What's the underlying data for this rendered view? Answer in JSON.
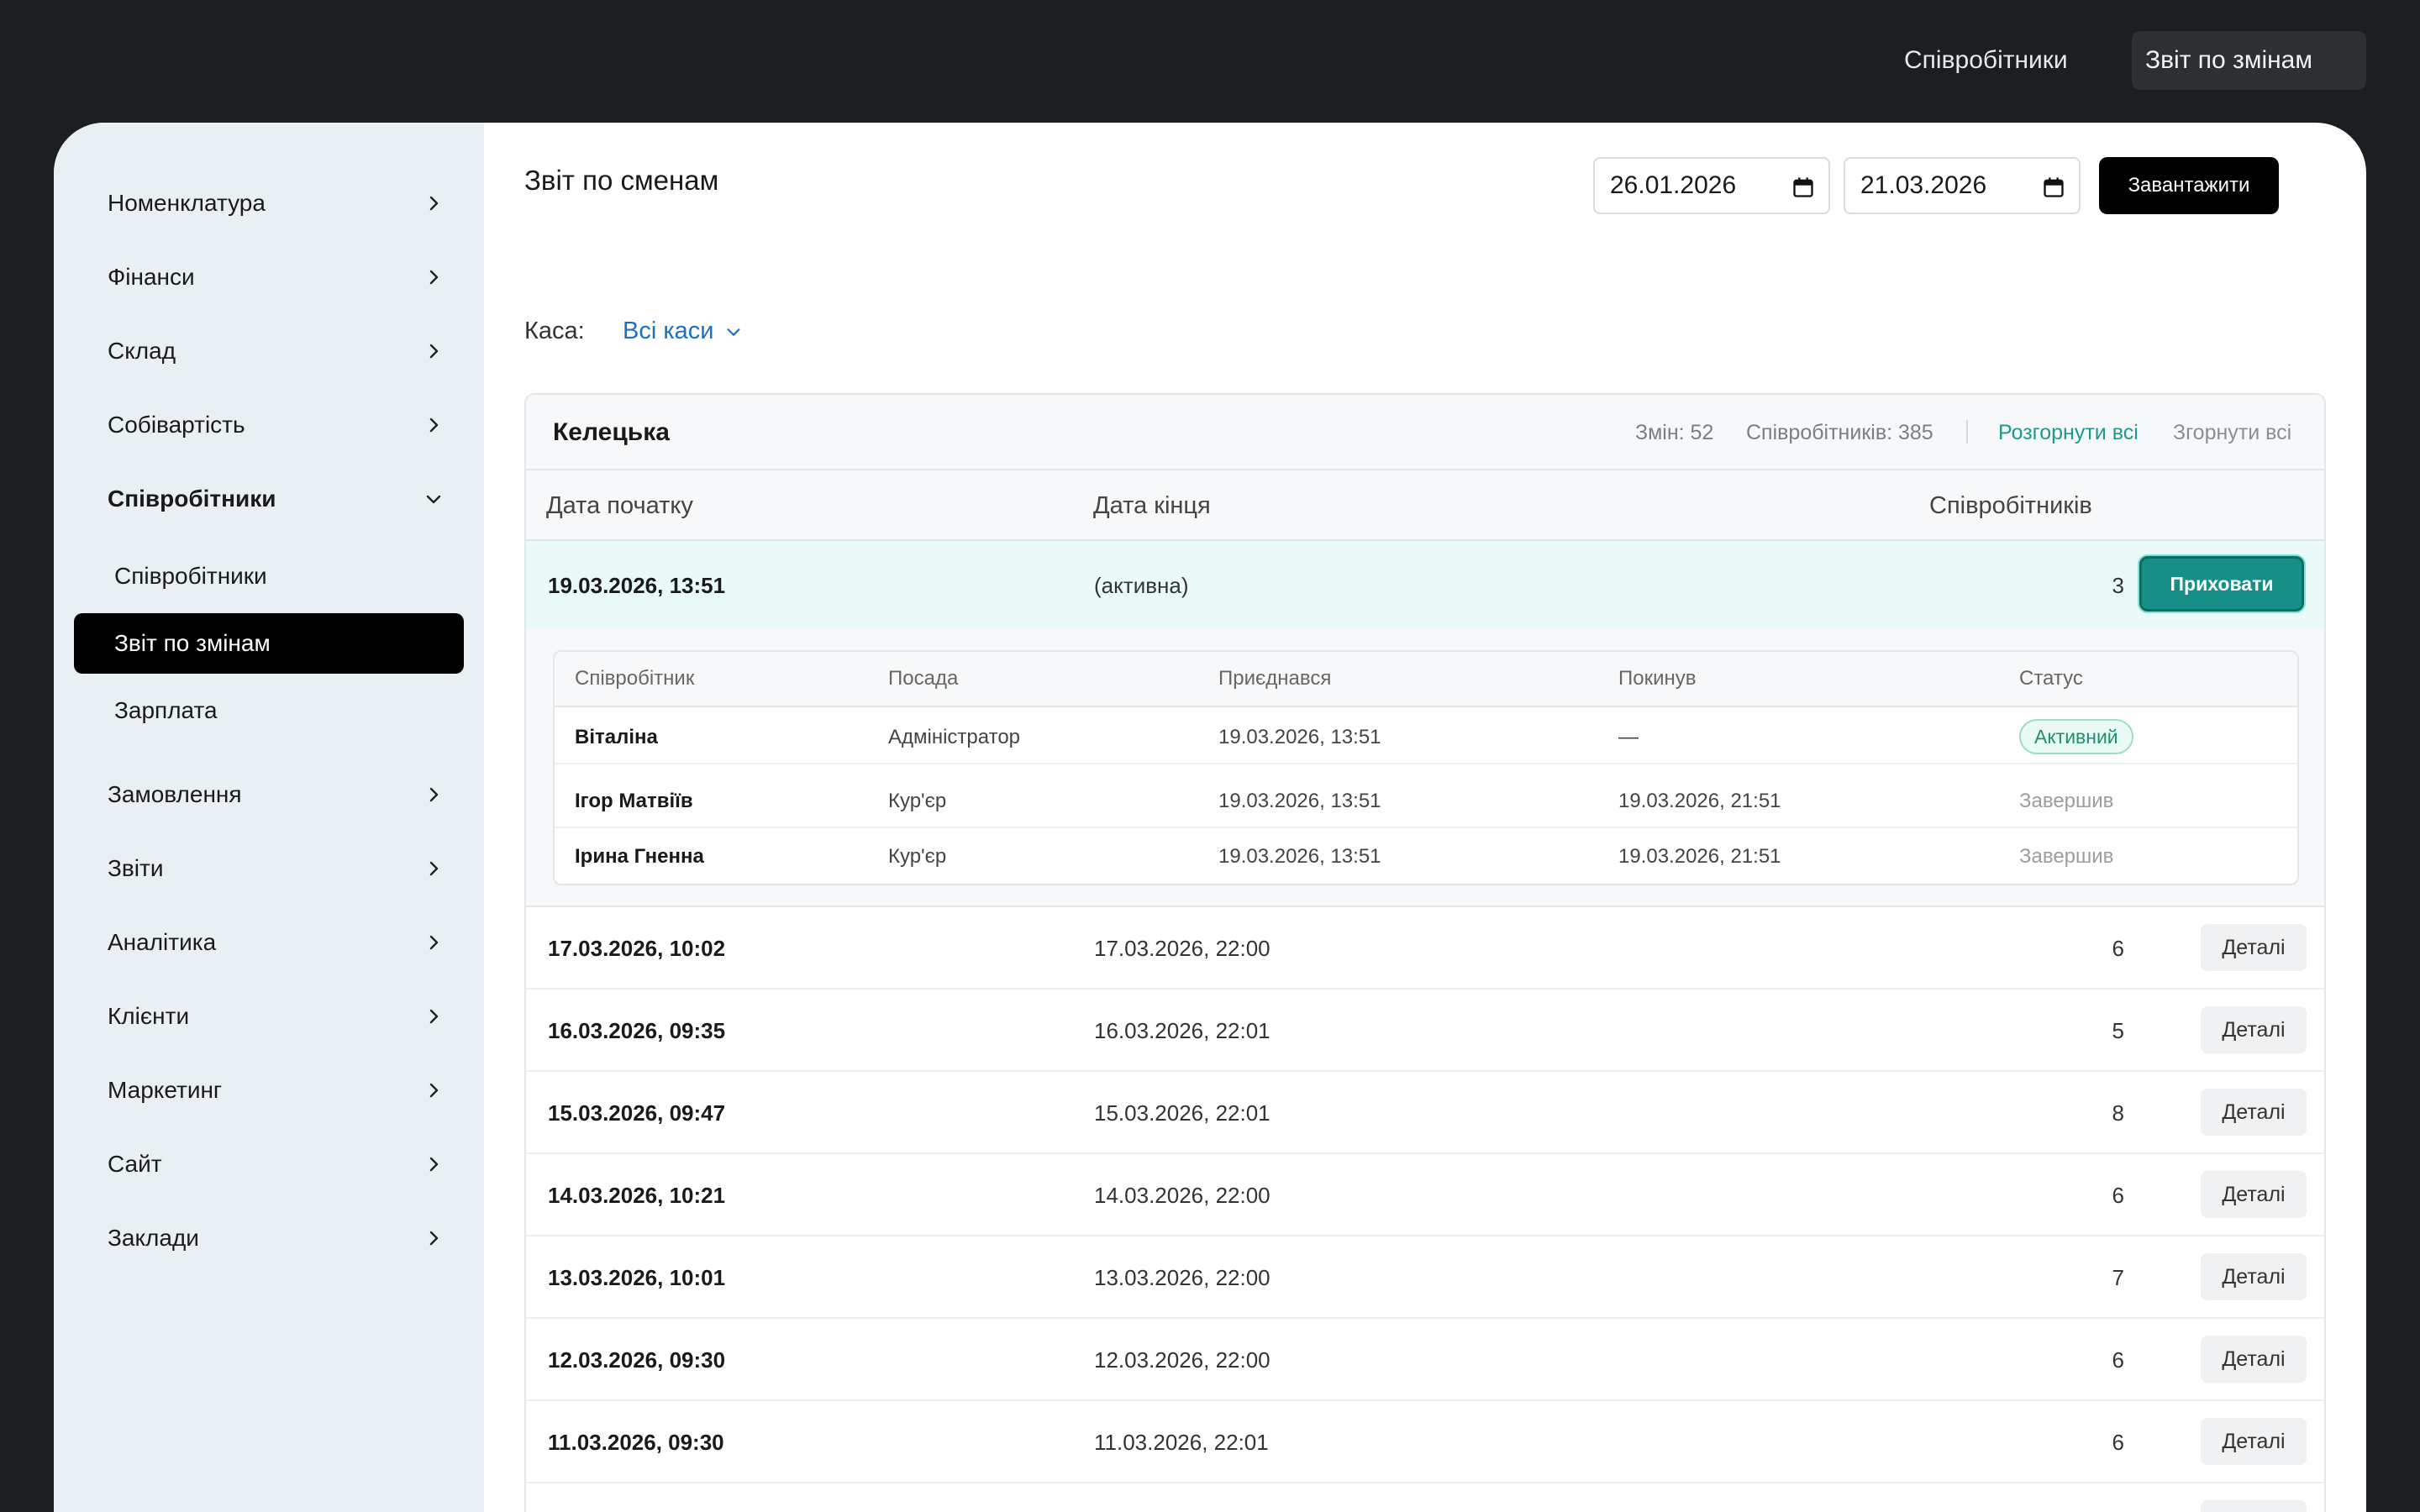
{
  "topnav": {
    "employees_link": "Співробітники",
    "shift_report_link": "Звіт по змінам"
  },
  "sidebar": {
    "items": [
      {
        "label": "Номенклатура"
      },
      {
        "label": "Фінанси"
      },
      {
        "label": "Склад"
      },
      {
        "label": "Собівартість"
      },
      {
        "label": "Співробітники",
        "expanded": true
      },
      {
        "label": "Замовлення"
      },
      {
        "label": "Звіти"
      },
      {
        "label": "Аналітика"
      },
      {
        "label": "Клієнти"
      },
      {
        "label": "Маркетинг"
      },
      {
        "label": "Сайт"
      },
      {
        "label": "Заклади"
      }
    ],
    "subitems": [
      {
        "label": "Співробітники"
      },
      {
        "label": "Звіт по змінам",
        "active": true
      },
      {
        "label": "Зарплата"
      }
    ]
  },
  "main": {
    "title": "Звіт по сменам",
    "date_from": "26.01.2026",
    "date_to": "21.03.2026",
    "load_button": "Завантажити",
    "kasa_label": "Каса:",
    "kasa_value": "Всі каси"
  },
  "group": {
    "name": "Келецька",
    "shifts_stat": "Змін: 52",
    "employees_stat": "Співробітників: 385",
    "expand_all": "Розгорнути всі",
    "collapse_all": "Згорнути всі",
    "columns": [
      "Дата початку",
      "Дата кінця",
      "Співробітників"
    ],
    "active_shift": {
      "start": "19.03.2026, 13:51",
      "end": "(активна)",
      "count": "3",
      "hide_button": "Приховати",
      "detail_columns": [
        "Співробітник",
        "Посада",
        "Приєднався",
        "Покинув",
        "Статус"
      ],
      "employees": [
        {
          "name": "Віталіна",
          "role": "Адміністратор",
          "joined": "19.03.2026, 13:51",
          "left": "—",
          "status": "Активний"
        },
        {
          "name": "Ігор Матвіїв",
          "role": "Кур'єр",
          "joined": "19.03.2026, 13:51",
          "left": "19.03.2026, 21:51",
          "status": "Завершив"
        },
        {
          "name": "Ірина Гненна",
          "role": "Кур'єр",
          "joined": "19.03.2026, 13:51",
          "left": "19.03.2026, 21:51",
          "status": "Завершив"
        }
      ]
    },
    "shifts": [
      {
        "start": "17.03.2026, 10:02",
        "end": "17.03.2026, 22:00",
        "count": "6",
        "button": "Деталі"
      },
      {
        "start": "16.03.2026, 09:35",
        "end": "16.03.2026, 22:01",
        "count": "5",
        "button": "Деталі"
      },
      {
        "start": "15.03.2026, 09:47",
        "end": "15.03.2026, 22:01",
        "count": "8",
        "button": "Деталі"
      },
      {
        "start": "14.03.2026, 10:21",
        "end": "14.03.2026, 22:00",
        "count": "6",
        "button": "Деталі"
      },
      {
        "start": "13.03.2026, 10:01",
        "end": "13.03.2026, 22:00",
        "count": "7",
        "button": "Деталі"
      },
      {
        "start": "12.03.2026, 09:30",
        "end": "12.03.2026, 22:00",
        "count": "6",
        "button": "Деталі"
      },
      {
        "start": "11.03.2026, 09:30",
        "end": "11.03.2026, 22:01",
        "count": "6",
        "button": "Деталі"
      }
    ]
  },
  "colors": {
    "accent_teal": "#178f86",
    "link_blue": "#1b6fc4",
    "active_row_bg": "#eafaf8",
    "dark_bg": "#1b1f22"
  }
}
